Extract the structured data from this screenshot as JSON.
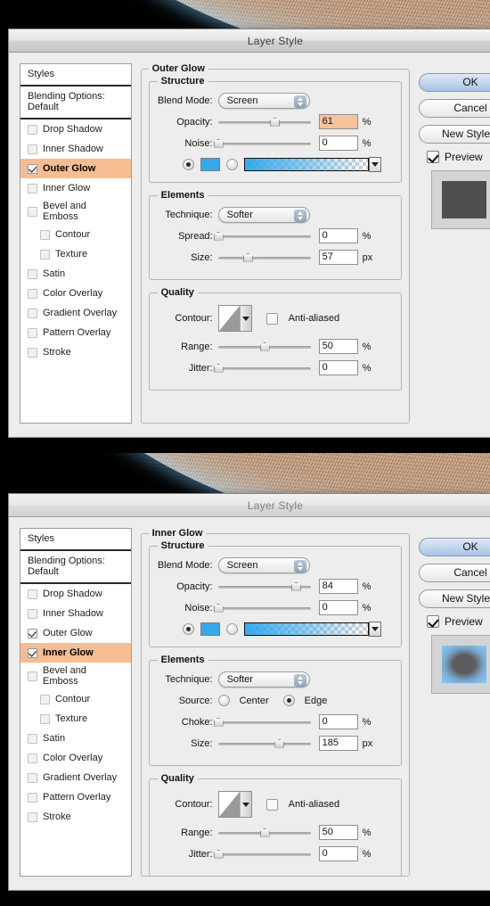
{
  "dialogs": [
    {
      "id": "outer-glow",
      "title": "Layer Style",
      "styles_header": "Styles",
      "blending_options": "Blending Options: Default",
      "effects": [
        {
          "label": "Drop Shadow",
          "checked": false,
          "selected": false,
          "indent": false
        },
        {
          "label": "Inner Shadow",
          "checked": false,
          "selected": false,
          "indent": false
        },
        {
          "label": "Outer Glow",
          "checked": true,
          "selected": true,
          "indent": false
        },
        {
          "label": "Inner Glow",
          "checked": false,
          "selected": false,
          "indent": false
        },
        {
          "label": "Bevel and Emboss",
          "checked": false,
          "selected": false,
          "indent": false
        },
        {
          "label": "Contour",
          "checked": false,
          "selected": false,
          "indent": true
        },
        {
          "label": "Texture",
          "checked": false,
          "selected": false,
          "indent": true
        },
        {
          "label": "Satin",
          "checked": false,
          "selected": false,
          "indent": false
        },
        {
          "label": "Color Overlay",
          "checked": false,
          "selected": false,
          "indent": false
        },
        {
          "label": "Gradient Overlay",
          "checked": false,
          "selected": false,
          "indent": false
        },
        {
          "label": "Pattern Overlay",
          "checked": false,
          "selected": false,
          "indent": false
        },
        {
          "label": "Stroke",
          "checked": false,
          "selected": false,
          "indent": false
        }
      ],
      "panel_title": "Outer Glow",
      "structure": {
        "legend": "Structure",
        "blend_mode_label": "Blend Mode:",
        "blend_mode_value": "Screen",
        "opacity_label": "Opacity:",
        "opacity_value": "61",
        "opacity_unit": "%",
        "opacity_selected": true,
        "opacity_pct": 61,
        "noise_label": "Noise:",
        "noise_value": "0",
        "noise_unit": "%",
        "noise_pct": 0,
        "color_mode": "gradient_off",
        "color_swatch": "#37a8ea"
      },
      "elements": {
        "legend": "Elements",
        "technique_label": "Technique:",
        "technique_value": "Softer",
        "has_source": false,
        "spread_label": "Spread:",
        "spread_value": "0",
        "spread_unit": "%",
        "spread_pct": 0,
        "size_label": "Size:",
        "size_value": "57",
        "size_unit": "px",
        "size_pct": 32
      },
      "quality": {
        "legend": "Quality",
        "contour_label": "Contour:",
        "antialiased_label": "Anti-aliased",
        "antialiased_checked": false,
        "range_label": "Range:",
        "range_value": "50",
        "range_unit": "%",
        "range_pct": 50,
        "jitter_label": "Jitter:",
        "jitter_value": "0",
        "jitter_unit": "%",
        "jitter_pct": 0
      },
      "actions": {
        "ok": "OK",
        "cancel": "Cancel",
        "new_style": "New Style...",
        "preview_label": "Preview",
        "preview_checked": true,
        "thumbnail": "dark-square"
      }
    },
    {
      "id": "inner-glow",
      "title": "Layer Style",
      "styles_header": "Styles",
      "blending_options": "Blending Options: Default",
      "effects": [
        {
          "label": "Drop Shadow",
          "checked": false,
          "selected": false,
          "indent": false
        },
        {
          "label": "Inner Shadow",
          "checked": false,
          "selected": false,
          "indent": false
        },
        {
          "label": "Outer Glow",
          "checked": true,
          "selected": false,
          "indent": false
        },
        {
          "label": "Inner Glow",
          "checked": true,
          "selected": true,
          "indent": false
        },
        {
          "label": "Bevel and Emboss",
          "checked": false,
          "selected": false,
          "indent": false
        },
        {
          "label": "Contour",
          "checked": false,
          "selected": false,
          "indent": true
        },
        {
          "label": "Texture",
          "checked": false,
          "selected": false,
          "indent": true
        },
        {
          "label": "Satin",
          "checked": false,
          "selected": false,
          "indent": false
        },
        {
          "label": "Color Overlay",
          "checked": false,
          "selected": false,
          "indent": false
        },
        {
          "label": "Gradient Overlay",
          "checked": false,
          "selected": false,
          "indent": false
        },
        {
          "label": "Pattern Overlay",
          "checked": false,
          "selected": false,
          "indent": false
        },
        {
          "label": "Stroke",
          "checked": false,
          "selected": false,
          "indent": false
        }
      ],
      "panel_title": "Inner Glow",
      "structure": {
        "legend": "Structure",
        "blend_mode_label": "Blend Mode:",
        "blend_mode_value": "Screen",
        "opacity_label": "Opacity:",
        "opacity_value": "84",
        "opacity_unit": "%",
        "opacity_selected": false,
        "opacity_pct": 84,
        "noise_label": "Noise:",
        "noise_value": "0",
        "noise_unit": "%",
        "noise_pct": 0,
        "color_mode": "gradient_off",
        "color_swatch": "#37a8ea"
      },
      "elements": {
        "legend": "Elements",
        "technique_label": "Technique:",
        "technique_value": "Softer",
        "has_source": true,
        "source_label": "Source:",
        "source_center_label": "Center",
        "source_edge_label": "Edge",
        "source_selected": "Edge",
        "spread_label": "Choke:",
        "spread_value": "0",
        "spread_unit": "%",
        "spread_pct": 0,
        "size_label": "Size:",
        "size_value": "185",
        "size_unit": "px",
        "size_pct": 66
      },
      "quality": {
        "legend": "Quality",
        "contour_label": "Contour:",
        "antialiased_label": "Anti-aliased",
        "antialiased_checked": false,
        "range_label": "Range:",
        "range_value": "50",
        "range_unit": "%",
        "range_pct": 50,
        "jitter_label": "Jitter:",
        "jitter_value": "0",
        "jitter_unit": "%",
        "jitter_pct": 0
      },
      "actions": {
        "ok": "OK",
        "cancel": "Cancel",
        "new_style": "New Style...",
        "preview_label": "Preview",
        "preview_checked": true,
        "thumbnail": "blue-glow-square"
      }
    }
  ]
}
